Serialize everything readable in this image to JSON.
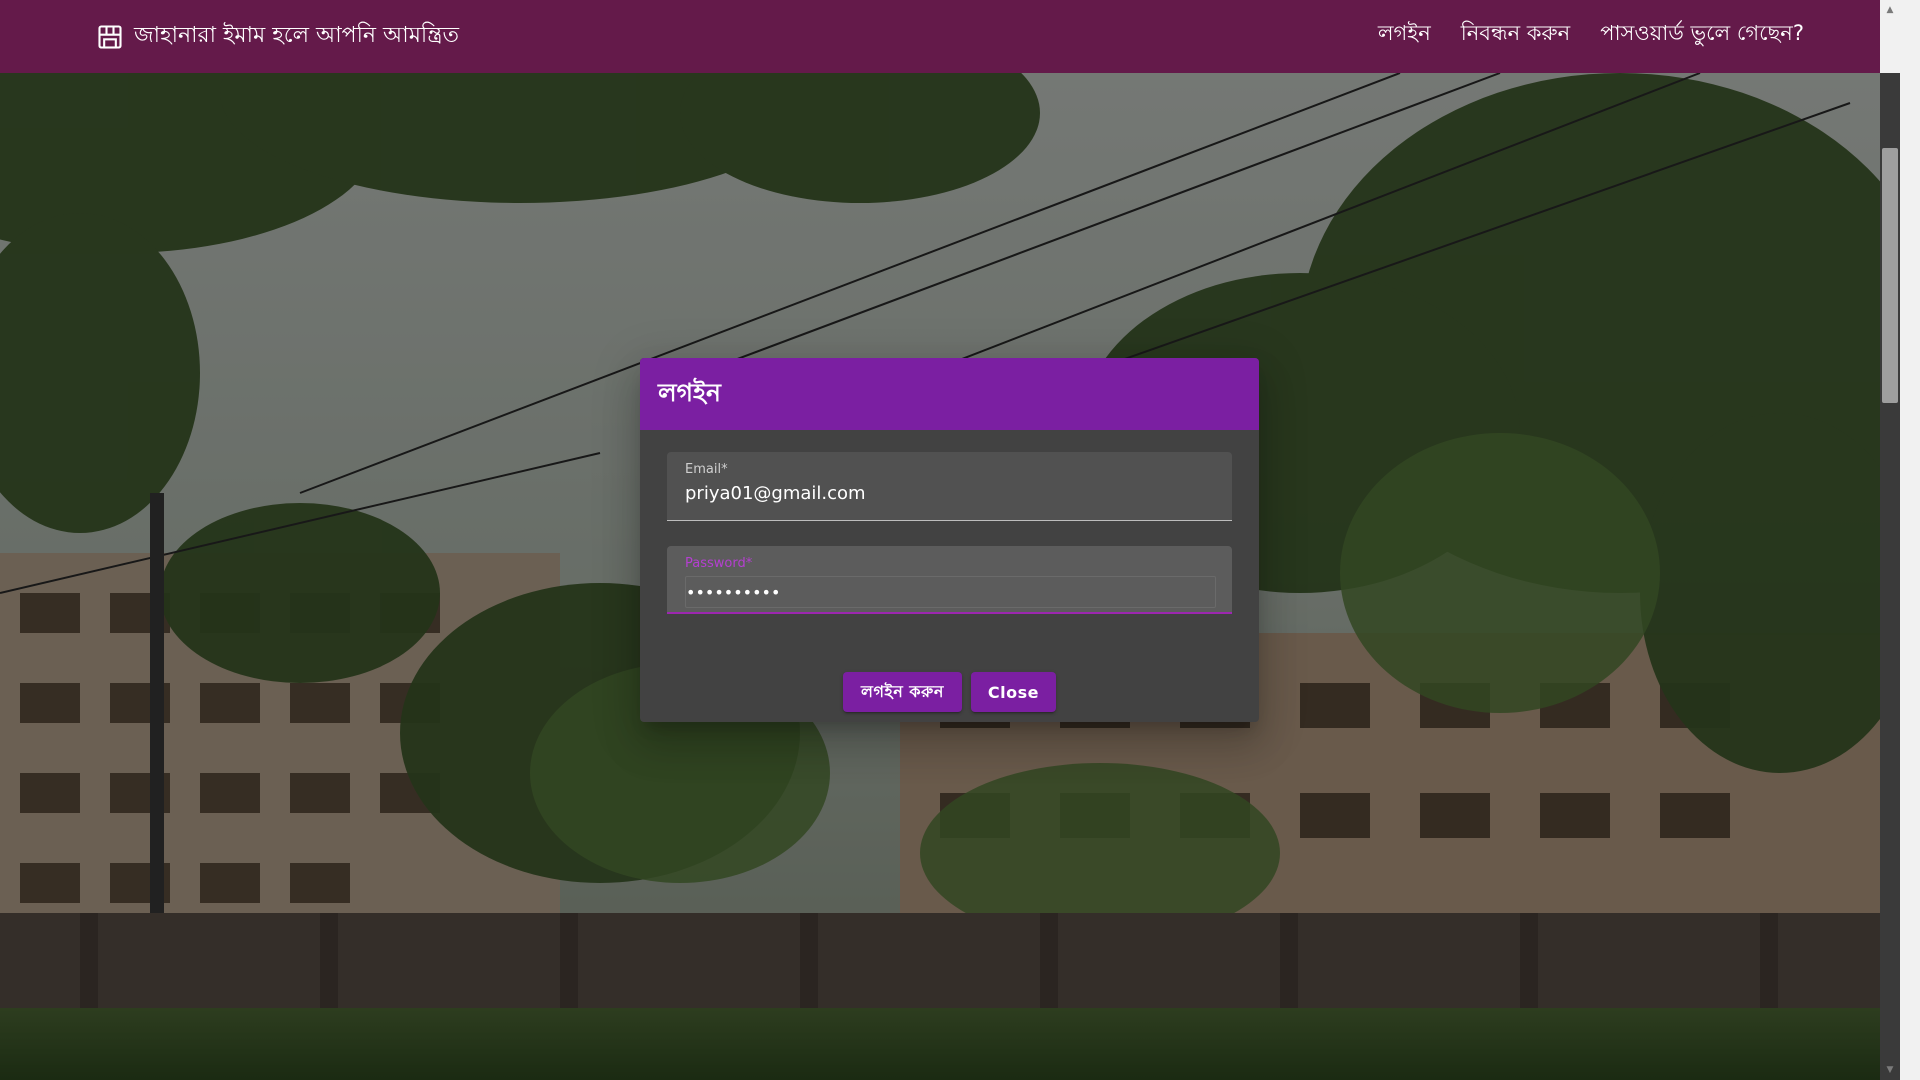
{
  "header": {
    "brand_icon": "storefront-icon",
    "brand_text": "জাহানারা ইমাম হলে আপনি আমন্ত্রিত",
    "nav": [
      {
        "label": "লগইন"
      },
      {
        "label": "নিবন্ধন করুন"
      },
      {
        "label": "পাসওয়ার্ড ভুলে গেছেন?"
      }
    ]
  },
  "dialog": {
    "title": "লগইন",
    "email": {
      "label": "Email*",
      "value": "priya01@gmail.com"
    },
    "password": {
      "label": "Password*",
      "value": "••••••••••"
    },
    "buttons": {
      "login": "লগইন করুন",
      "close": "Close"
    }
  },
  "colors": {
    "appbar": "#641a4a",
    "dialog_header": "#7b1fa2",
    "dialog_body": "#424242",
    "accent": "#9c27b0"
  }
}
